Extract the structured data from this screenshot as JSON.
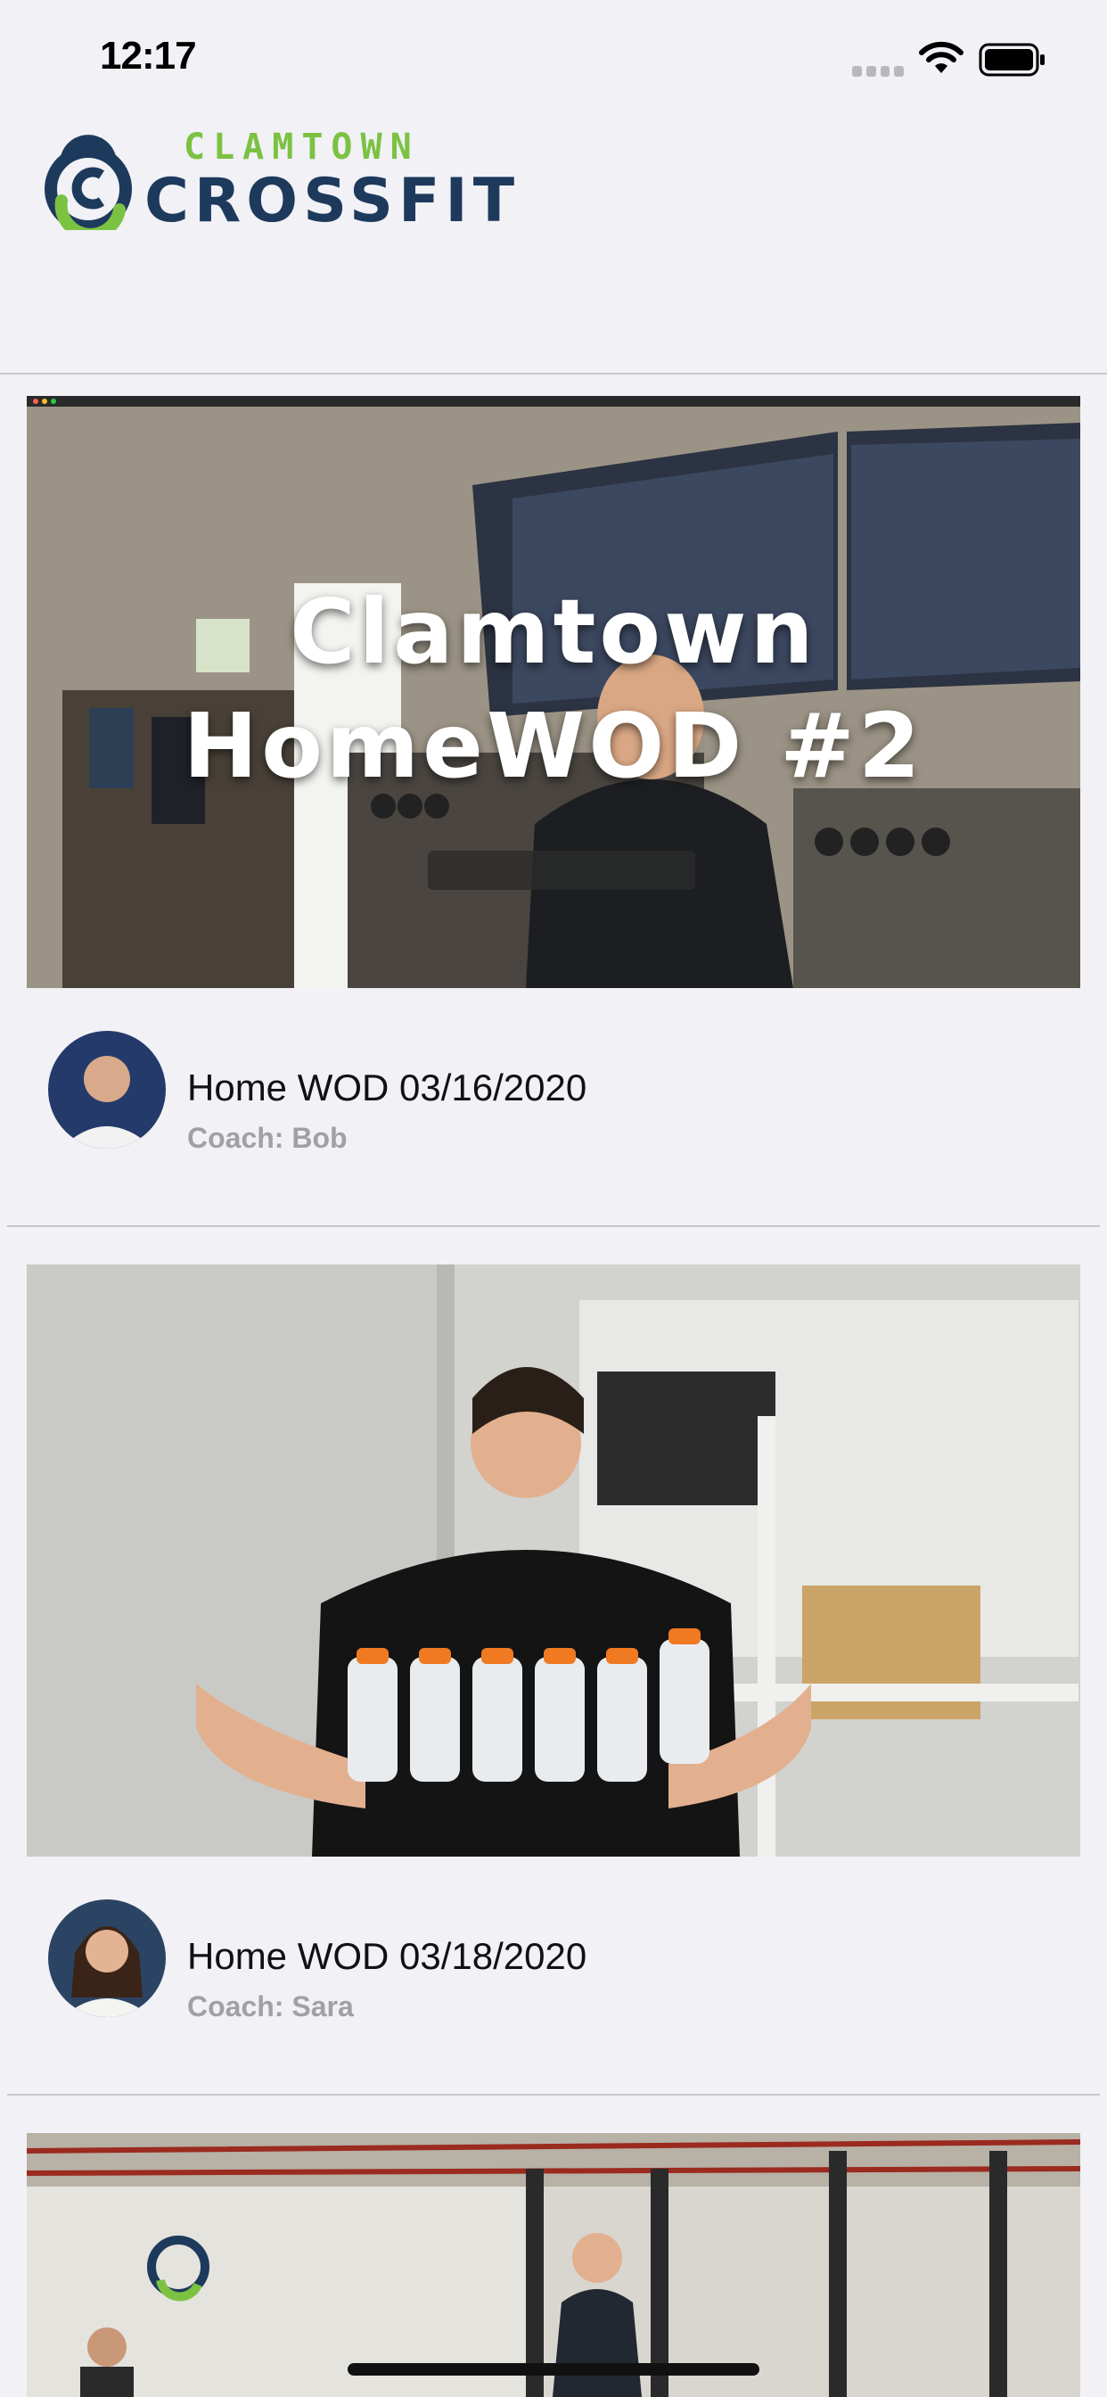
{
  "status_bar": {
    "time": "12:17",
    "icons": [
      "signal-icon",
      "wifi-icon",
      "battery-icon"
    ]
  },
  "header": {
    "logo_line1": "CLAMTOWN",
    "logo_line2": "CROSSFIT",
    "colors": {
      "green": "#7cc242",
      "navy": "#1d3a5c"
    }
  },
  "feed": [
    {
      "thumbnail_overlay_title": [
        "Clamtown",
        "HomeWOD #2"
      ],
      "title": "Home WOD 03/16/2020",
      "coach": "Coach: Bob"
    },
    {
      "thumbnail_overlay_title": [],
      "title": "Home WOD 03/18/2020",
      "coach": "Coach: Sara"
    },
    {
      "thumbnail_overlay_title": [],
      "title": "",
      "coach": ""
    }
  ]
}
